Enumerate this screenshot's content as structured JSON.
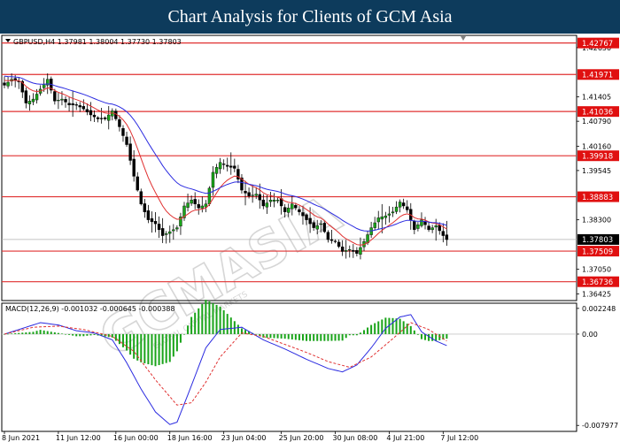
{
  "banner": {
    "title": "Chart Analysis for Clients of GCM Asia"
  },
  "chart_header": {
    "symbol_line": "GBPUSD,H4  1.37981 1.38004 1.37730 1.37803"
  },
  "watermark": {
    "text": "GCMASIA",
    "subtext": "GLOBAL CAPITAL MARKETS"
  },
  "chart_data": {
    "type": "candlestick",
    "symbol": "GBPUSD",
    "timeframe": "H4",
    "ohlc_last": {
      "open": 1.37981,
      "high": 1.38004,
      "low": 1.3773,
      "close": 1.37803
    },
    "current_price": "1.37803",
    "ylim": [
      1.3626,
      1.4296
    ],
    "price_ticks": [
      "1.42650",
      "1.41405",
      "1.40790",
      "1.40160",
      "1.39545",
      "1.38300",
      "1.37050",
      "1.36425"
    ],
    "x_tick_labels": [
      "8 Jun 2021",
      "11 Jun 12:00",
      "16 Jun 00:00",
      "18 Jun 16:00",
      "23 Jun 04:00",
      "25 Jun 20:00",
      "30 Jun 08:00",
      "4 Jul 21:00",
      "7 Jul 12:00"
    ],
    "x_tick_index": [
      0,
      15,
      31,
      46,
      61,
      77,
      92,
      107,
      122
    ],
    "levels": [
      {
        "label": "1.42767",
        "value": 1.42767
      },
      {
        "label": "1.41971",
        "value": 1.41971
      },
      {
        "label": "1.41036",
        "value": 1.41036
      },
      {
        "label": "1.39918",
        "value": 1.39918
      },
      {
        "label": "1.38883",
        "value": 1.38883
      },
      {
        "label": "1.37509",
        "value": 1.37509
      },
      {
        "label": "1.36736",
        "value": 1.36736
      }
    ],
    "close_anchors": [
      [
        0,
        1.417
      ],
      [
        2,
        1.4185
      ],
      [
        4,
        1.418
      ],
      [
        6,
        1.4125
      ],
      [
        8,
        1.4135
      ],
      [
        10,
        1.416
      ],
      [
        12,
        1.4185
      ],
      [
        14,
        1.413
      ],
      [
        16,
        1.4135
      ],
      [
        18,
        1.412
      ],
      [
        20,
        1.412
      ],
      [
        22,
        1.411
      ],
      [
        24,
        1.4095
      ],
      [
        26,
        1.4085
      ],
      [
        28,
        1.4085
      ],
      [
        30,
        1.4105
      ],
      [
        32,
        1.4065
      ],
      [
        34,
        1.402
      ],
      [
        36,
        1.394
      ],
      [
        38,
        1.387
      ],
      [
        40,
        1.383
      ],
      [
        42,
        1.382
      ],
      [
        44,
        1.379
      ],
      [
        46,
        1.38
      ],
      [
        48,
        1.381
      ],
      [
        50,
        1.3865
      ],
      [
        52,
        1.388
      ],
      [
        54,
        1.386
      ],
      [
        56,
        1.387
      ],
      [
        58,
        1.395
      ],
      [
        60,
        1.3975
      ],
      [
        62,
        1.3965
      ],
      [
        64,
        1.396
      ],
      [
        66,
        1.3905
      ],
      [
        68,
        1.389
      ],
      [
        70,
        1.3895
      ],
      [
        72,
        1.3865
      ],
      [
        74,
        1.388
      ],
      [
        76,
        1.388
      ],
      [
        78,
        1.385
      ],
      [
        80,
        1.387
      ],
      [
        82,
        1.385
      ],
      [
        84,
        1.383
      ],
      [
        86,
        1.381
      ],
      [
        88,
        1.382
      ],
      [
        90,
        1.378
      ],
      [
        92,
        1.3775
      ],
      [
        94,
        1.375
      ],
      [
        96,
        1.3755
      ],
      [
        98,
        1.3745
      ],
      [
        100,
        1.3775
      ],
      [
        102,
        1.381
      ],
      [
        104,
        1.3835
      ],
      [
        106,
        1.384
      ],
      [
        108,
        1.385
      ],
      [
        110,
        1.3875
      ],
      [
        112,
        1.3855
      ],
      [
        114,
        1.3805
      ],
      [
        116,
        1.383
      ],
      [
        118,
        1.3805
      ],
      [
        120,
        1.3815
      ],
      [
        122,
        1.379
      ],
      [
        123,
        1.378
      ]
    ],
    "ma_fast_label": "moving average (red)",
    "ma_slow_label": "moving average (blue)",
    "macd": {
      "label": "MACD(12,26,9) -0.001032 -0.000645 -0.000388",
      "params": [
        12,
        26,
        9
      ],
      "values": {
        "macd": -0.001032,
        "signal": -0.000645,
        "hist": -0.000388
      },
      "ticks": [
        "0.002248",
        "0.00",
        "-0.007977"
      ],
      "ylim": [
        -0.0085,
        0.0027
      ],
      "main_anchors": [
        [
          0,
          0.0
        ],
        [
          5,
          0.0005
        ],
        [
          10,
          0.001
        ],
        [
          15,
          0.0008
        ],
        [
          20,
          0.0003
        ],
        [
          25,
          0.0001
        ],
        [
          30,
          -0.0005
        ],
        [
          34,
          -0.0025
        ],
        [
          38,
          -0.0048
        ],
        [
          42,
          -0.0068
        ],
        [
          46,
          -0.0079
        ],
        [
          48,
          -0.0077
        ],
        [
          52,
          -0.0045
        ],
        [
          56,
          -0.0012
        ],
        [
          60,
          0.0004
        ],
        [
          66,
          0.0006
        ],
        [
          72,
          -0.0005
        ],
        [
          78,
          -0.0013
        ],
        [
          84,
          -0.0022
        ],
        [
          90,
          -0.003
        ],
        [
          94,
          -0.0033
        ],
        [
          98,
          -0.0027
        ],
        [
          102,
          -0.0012
        ],
        [
          106,
          0.0005
        ],
        [
          110,
          0.0015
        ],
        [
          113,
          0.0017
        ],
        [
          116,
          0.0002
        ],
        [
          120,
          -0.0006
        ],
        [
          123,
          -0.001
        ]
      ],
      "signal_anchors": [
        [
          0,
          0.0
        ],
        [
          8,
          0.0006
        ],
        [
          15,
          0.0007
        ],
        [
          22,
          0.0004
        ],
        [
          30,
          -0.0002
        ],
        [
          36,
          -0.0015
        ],
        [
          42,
          -0.004
        ],
        [
          48,
          -0.0062
        ],
        [
          52,
          -0.006
        ],
        [
          56,
          -0.0042
        ],
        [
          60,
          -0.002
        ],
        [
          66,
          0.0001
        ],
        [
          72,
          -0.0002
        ],
        [
          78,
          -0.0009
        ],
        [
          84,
          -0.0016
        ],
        [
          90,
          -0.0024
        ],
        [
          96,
          -0.0029
        ],
        [
          102,
          -0.002
        ],
        [
          108,
          -0.0004
        ],
        [
          113,
          0.001
        ],
        [
          118,
          0.0004
        ],
        [
          123,
          -0.0006
        ]
      ]
    }
  },
  "colors": {
    "banner": "#0d3b5c",
    "level_line": "#e03030",
    "level_tag": "#e01010",
    "ma_fast": "#e03030",
    "ma_slow": "#2a2ae0",
    "macd_hist": "#1aa41a",
    "macd_main": "#2a2ae0",
    "macd_signal": "#e03030",
    "candle_up": "#1aa41a",
    "candle_down": "#000000",
    "current_tag": "#000000"
  }
}
